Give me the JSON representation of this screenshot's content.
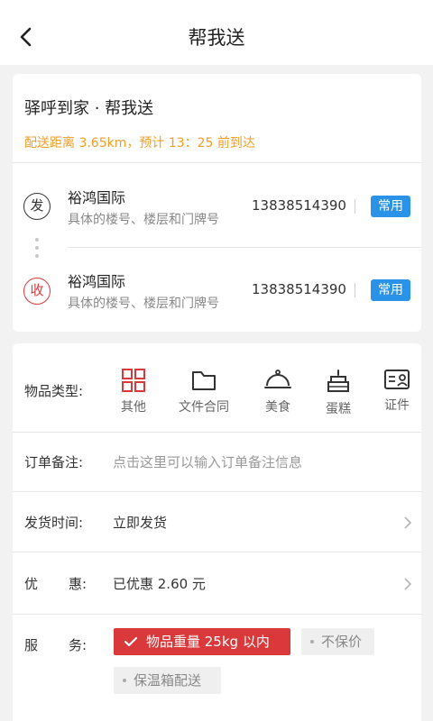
{
  "header": {
    "title": "帮我送",
    "back_icon": "chevron-left-icon"
  },
  "order": {
    "title": "驿呼到家 · 帮我送",
    "eta_text": "配送距离 3.65km，预计 13：25 前到达",
    "eta_color": "#f39c26"
  },
  "sender": {
    "badge": "发",
    "name": "裕鸿国际",
    "detail_placeholder": "具体的楼号、楼层和门牌号",
    "phone": "13838514390",
    "tag": "常用"
  },
  "receiver": {
    "badge": "收",
    "name": "裕鸿国际",
    "detail_placeholder": "具体的楼号、楼层和门牌号",
    "phone": "13838514390",
    "tag": "常用"
  },
  "item_type": {
    "label": "物品类型:",
    "options": [
      {
        "label": "其他",
        "icon": "grid-icon",
        "selected": true
      },
      {
        "label": "文件合同",
        "icon": "folder-icon",
        "selected": false
      },
      {
        "label": "美食",
        "icon": "food-cloche-icon",
        "selected": false
      },
      {
        "label": "蛋糕",
        "icon": "cake-icon",
        "selected": false
      },
      {
        "label": "证件",
        "icon": "id-card-icon",
        "selected": false
      }
    ]
  },
  "remark": {
    "label": "订单备注:",
    "placeholder": "点击这里可以输入订单备注信息"
  },
  "ship_time": {
    "label": "发货时间:",
    "value": "立即发货"
  },
  "discount": {
    "label_a": "优",
    "label_b": "惠:",
    "value": "已优惠 2.60 元"
  },
  "service": {
    "label_a": "服",
    "label_b": "务:",
    "options": [
      {
        "label": "物品重量 25kg 以内",
        "selected": true
      },
      {
        "label": "不保价",
        "selected": false
      },
      {
        "label": "保温箱配送",
        "selected": false
      }
    ]
  },
  "colors": {
    "accent_red": "#d9393b",
    "tag_blue": "#2a93e8",
    "orange": "#f39c26"
  }
}
